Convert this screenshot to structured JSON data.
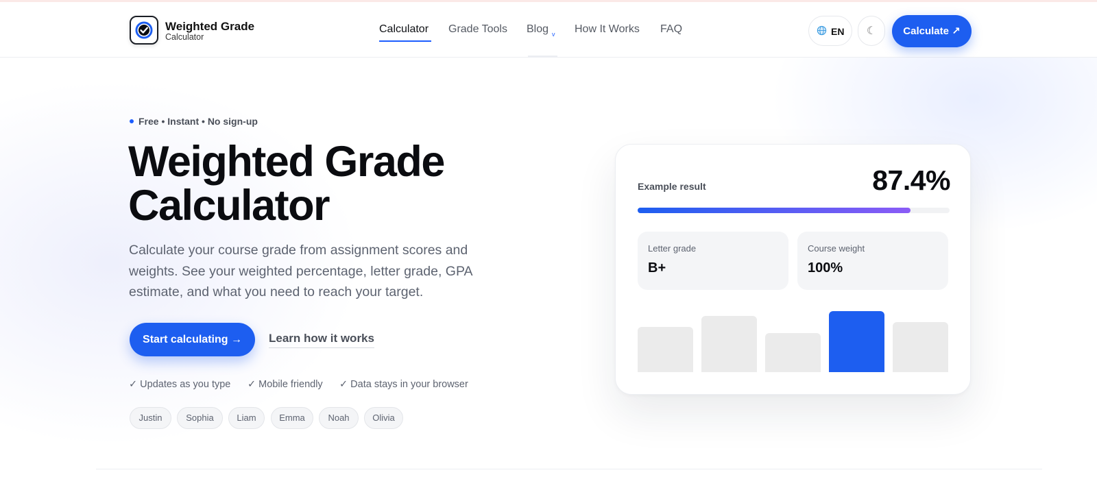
{
  "brand": {
    "title": "Weighted Grade",
    "subtitle": "Calculator"
  },
  "nav": {
    "items": [
      {
        "label": "Calculator",
        "active": true
      },
      {
        "label": "Grade Tools",
        "active": false
      },
      {
        "label": "Blog",
        "active": false,
        "dropdown": true
      },
      {
        "label": "How It Works",
        "active": false
      },
      {
        "label": "FAQ",
        "active": false
      }
    ],
    "blog_caret": "v"
  },
  "header": {
    "language": "EN",
    "theme_icon": "☾",
    "cta_label": "Calculate ↗"
  },
  "hero": {
    "eyebrow": "Free • Instant • No sign-up",
    "title_line1": "Weighted Grade",
    "title_line2": "Calculator",
    "description": "Calculate your course grade from assignment scores and weights. See your weighted percentage, letter grade, GPA estimate, and what you need to reach your target.",
    "primary_button": "Start calculating →",
    "secondary_link": "Learn how it works",
    "features": [
      "✓ Updates as you type",
      "✓ Mobile friendly",
      "✓ Data stays in your browser"
    ],
    "chips": [
      "Justin",
      "Sophia",
      "Liam",
      "Emma",
      "Noah",
      "Olivia"
    ]
  },
  "card": {
    "label": "Example result",
    "value": "87.4%",
    "progress_percent": 87.4,
    "letter_grade_label": "Letter grade",
    "letter_grade_value": "B+",
    "course_weight_label": "Course weight",
    "course_weight_value": "100%",
    "bars": [
      {
        "level": 0.81,
        "highlight": false
      },
      {
        "level": 1.0,
        "highlight": false
      },
      {
        "level": 0.7,
        "highlight": false
      },
      {
        "level": 1.08,
        "highlight": true
      },
      {
        "level": 0.89,
        "highlight": false
      }
    ]
  },
  "colors": {
    "accent": "#1d5ef0",
    "gradient_end": "#8b5cf6",
    "text": "#0b0c10",
    "muted": "#5d6370"
  }
}
